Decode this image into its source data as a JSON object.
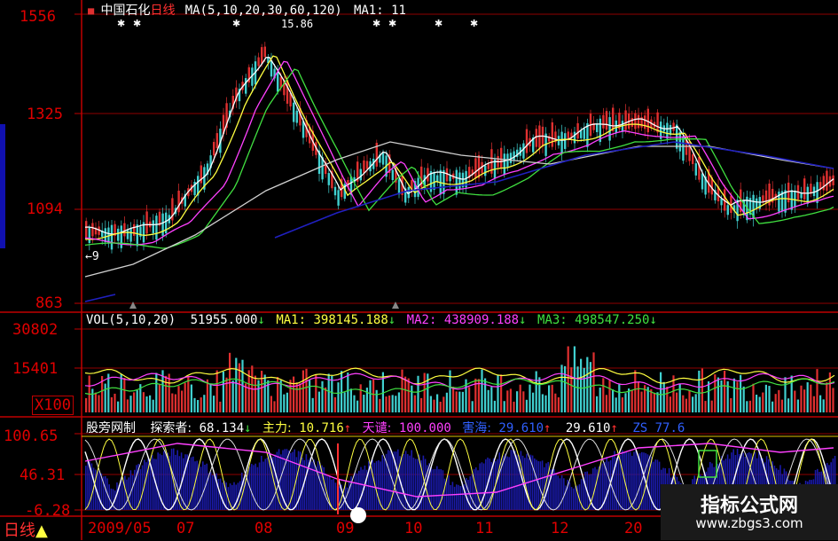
{
  "price_panel": {
    "name_text": "中国石化",
    "period_text": "日线",
    "ma_text": "MA(5,10,20,30,60,120)",
    "ma1_text": "MA1: 11",
    "high_label": "15.86",
    "low_label": "9",
    "ticks": [
      "1556",
      "1325",
      "1094",
      "863"
    ]
  },
  "volume_panel": {
    "title": "VOL(5,10,20)",
    "vol_value": "51955.000",
    "ma1_label": "MA1:",
    "ma1_value": "398145.188",
    "ma2_label": "MA2:",
    "ma2_value": "438909.188",
    "ma3_label": "MA3:",
    "ma3_value": "498547.250",
    "ticks": [
      "30802",
      "15401"
    ],
    "multiplier": "X100"
  },
  "indicator_panel": {
    "title": "股旁网制",
    "explorer_label": "探索者:",
    "explorer_value": "68.134",
    "main_label": "主力:",
    "main_value": "10.716",
    "sky_label": "天谴:",
    "sky_value": "100.000",
    "harm_label": "害海:",
    "harm_value": "29.610",
    "harm_value2": "29.610",
    "zs_label": "ZS",
    "zs_value": "77.6",
    "ticks": [
      "100.65",
      "46.31",
      "-6.28"
    ]
  },
  "bottom_bar": {
    "period": "日线",
    "dates": [
      "2009/05",
      "07",
      "08",
      "09",
      "10",
      "11",
      "12",
      "20"
    ]
  },
  "watermark": {
    "title": "指标公式网",
    "url": "www.zbgs3.com"
  },
  "colors": {
    "grid": "#c00000",
    "up": "#e03030",
    "down": "#40d0d0",
    "ma5": "#ffffff",
    "ma10": "#ffff40",
    "ma20": "#ff40ff",
    "ma30": "#40e040",
    "ma60": "#d0d0d0",
    "ma120": "#2020c0"
  }
}
